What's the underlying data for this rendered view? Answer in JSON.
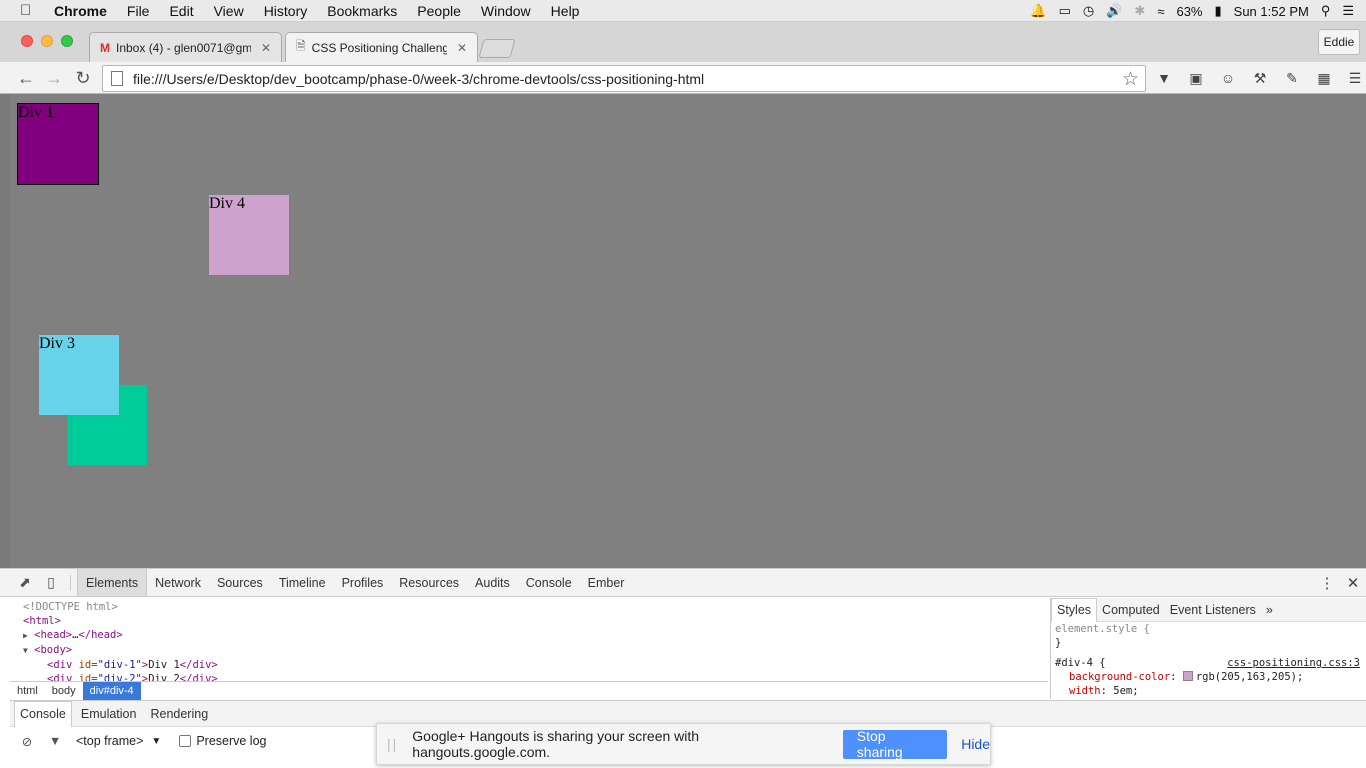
{
  "menubar": {
    "app": "Chrome",
    "items": [
      "File",
      "Edit",
      "View",
      "History",
      "Bookmarks",
      "People",
      "Window",
      "Help"
    ],
    "battery": "63%",
    "clock": "Sun 1:52 PM"
  },
  "tabs": [
    {
      "title": "Inbox (4) - glen0071@gma",
      "icon": "gmail-icon"
    },
    {
      "title": "CSS Positioning Challenge",
      "icon": "page-icon"
    }
  ],
  "user": "Eddie",
  "omnibox": {
    "url": "file:///Users/e/Desktop/dev_bootcamp/phase-0/week-3/chrome-devtools/css-positioning-html"
  },
  "page": {
    "boxes": [
      {
        "label": "Div 1",
        "color": "#800080"
      },
      {
        "label": "Div 4",
        "color": "#cda3cd"
      },
      {
        "label": "",
        "color": "#00cc99"
      },
      {
        "label": "Div 3",
        "color": "#66d3e8"
      }
    ],
    "background": "#808080"
  },
  "devtools": {
    "tabs": [
      "Elements",
      "Network",
      "Sources",
      "Timeline",
      "Profiles",
      "Resources",
      "Audits",
      "Console",
      "Ember"
    ],
    "dom": {
      "doctype": "<!DOCTYPE html>",
      "html": "<html>",
      "head_open": "<head>",
      "head_ellipsis": "…",
      "head_close": "</head>",
      "body": "<body>",
      "div1_text": "Div 1",
      "div2_text": "Div 2"
    },
    "breadcrumbs": [
      "html",
      "body",
      "div#div-4"
    ],
    "styles_tabs": [
      "Styles",
      "Computed",
      "Event Listeners"
    ],
    "styles": {
      "element_style": "element.style {",
      "close": "}",
      "selector": "#div-4 {",
      "source": "css-positioning.css:3",
      "prop1": "background-color",
      "val1": "rgb(205,163,205);",
      "prop2": "width",
      "val2": "5em;"
    },
    "drawer_tabs": [
      "Console",
      "Emulation",
      "Rendering"
    ],
    "frame": "<top frame>",
    "preserve_log": "Preserve log"
  },
  "hangouts": {
    "message": "Google+ Hangouts is sharing your screen with hangouts.google.com.",
    "stop_label": "Stop sharing",
    "hide_label": "Hide"
  }
}
